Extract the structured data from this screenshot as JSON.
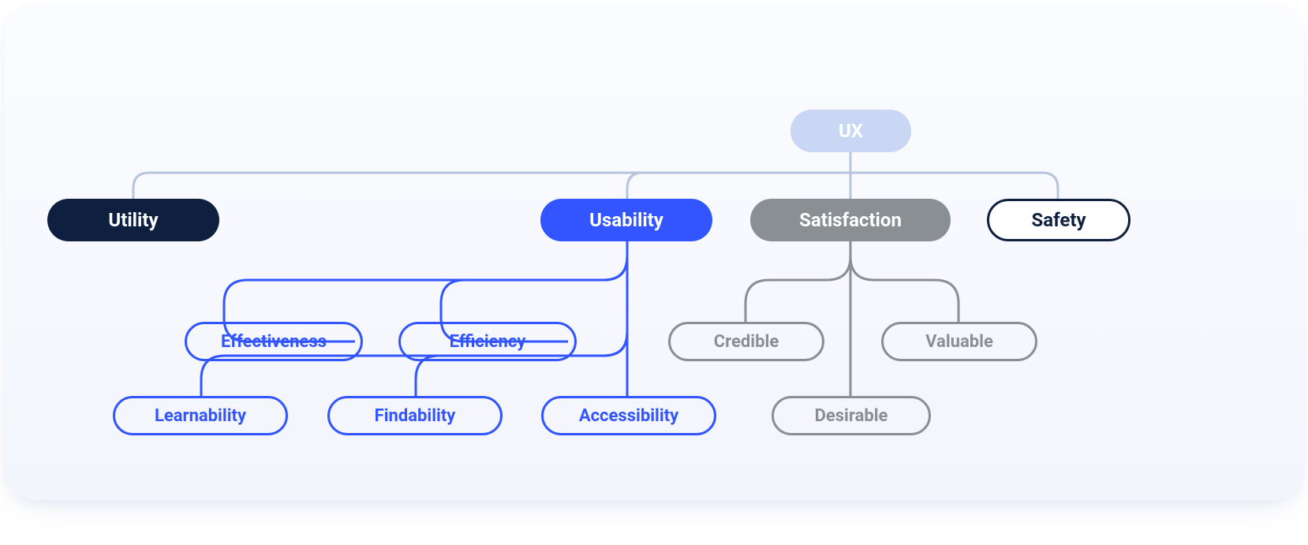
{
  "diagram": {
    "root": "UX",
    "level1": {
      "utility": "Utility",
      "usability": "Usability",
      "satisfaction": "Satisfaction",
      "safety": "Safety"
    },
    "usability_children": {
      "effectiveness": "Effectiveness",
      "efficiency": "Efficiency",
      "learnability": "Learnability",
      "findability": "Findability",
      "accessibility": "Accessibility"
    },
    "satisfaction_children": {
      "credible": "Credible",
      "valuable": "Valuable",
      "desirable": "Desirable"
    }
  },
  "colors": {
    "root_bg": "#c9d6f4",
    "navy": "#0f1f3f",
    "blue": "#3355ff",
    "gray": "#8a8f94",
    "connector_light": "#b8c4de"
  }
}
